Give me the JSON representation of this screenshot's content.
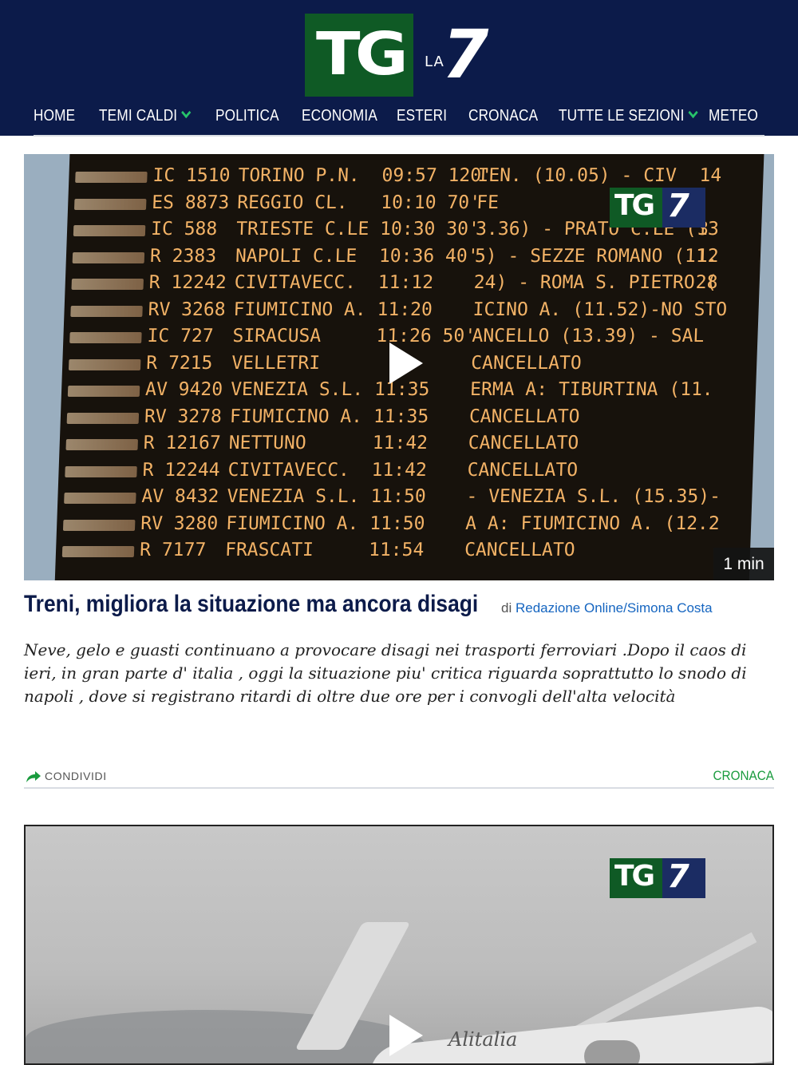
{
  "header": {
    "logo": {
      "tg": "TG",
      "la": "LA",
      "seven": "7"
    },
    "nav": [
      {
        "label": "HOME"
      },
      {
        "label": "TEMI CALDI"
      },
      {
        "label": "POLITICA"
      },
      {
        "label": "ECONOMIA"
      },
      {
        "label": "ESTERI"
      },
      {
        "label": "CRONACA"
      },
      {
        "label": "TUTTE LE SEZIONI"
      },
      {
        "label": "METEO"
      }
    ],
    "colors": {
      "background": "#0c1b4a",
      "accent": "#27c46a",
      "logo_green": "#0f5a25"
    }
  },
  "video1": {
    "duration": "1 min",
    "watermark": {
      "tg": "TG",
      "seven": "7"
    },
    "board_rows": [
      [
        "IC 1510",
        "TORINO P.N.",
        "09:57 120'",
        "IEN. (10.05) - CIV",
        "14"
      ],
      [
        "ES 8873",
        "REGGIO CL.",
        "10:10 70'",
        "FE",
        ""
      ],
      [
        "IC 588",
        "TRIESTE C.LE",
        "10:30 30'",
        "3.36) - PRATO C.LE (13",
        "3"
      ],
      [
        "R 2383",
        "NAPOLI C.LE",
        "10:36 40'",
        "5) - SEZZE ROMANO (11.",
        "12"
      ],
      [
        "R 12242",
        "CIVITAVECC.",
        "11:12",
        "24) - ROMA S. PIETRO (",
        "28"
      ],
      [
        "RV 3268",
        "FIUMICINO A.",
        "11:20",
        "ICINO A. (11.52)-NO STO",
        ""
      ],
      [
        "IC 727",
        "SIRACUSA",
        "11:26 50'",
        "ANCELLO (13.39) - SAL",
        ""
      ],
      [
        "R 7215",
        "VELLETRI",
        "",
        "CANCELLATO",
        ""
      ],
      [
        "AV 9420",
        "VENEZIA S.L.",
        "11:35",
        "ERMA A: TIBURTINA (11.",
        ""
      ],
      [
        "RV 3278",
        "FIUMICINO A.",
        "11:35",
        "CANCELLATO",
        ""
      ],
      [
        "R 12167",
        "NETTUNO",
        "11:42",
        "CANCELLATO",
        ""
      ],
      [
        "R 12244",
        "CIVITAVECC.",
        "11:42",
        "CANCELLATO",
        ""
      ],
      [
        "AV 8432",
        "VENEZIA S.L.",
        "11:50",
        "- VENEZIA S.L. (15.35)-",
        ""
      ],
      [
        "RV 3280",
        "FIUMICINO A.",
        "11:50",
        "A A: FIUMICINO A. (12.2",
        ""
      ],
      [
        "R 7177",
        "FRASCATI",
        "11:54",
        "CANCELLATO",
        ""
      ]
    ]
  },
  "article": {
    "title": "Treni, migliora la situazione ma ancora disagi",
    "by_prefix": "di",
    "author": "Redazione Online/Simona Costa",
    "summary": "Neve, gelo e guasti continuano a provocare  disagi nei trasporti ferroviari .Dopo il caos di ieri, in gran parte d' italia ,  oggi la situazione piu' critica riguarda soprattutto lo snodo di napoli , dove si registrano ritardi di oltre due ore per i convogli dell'alta velocità",
    "share_label": "CONDIVIDI",
    "category": "CRONACA"
  },
  "video2": {
    "watermark": {
      "tg": "TG",
      "seven": "7"
    },
    "plane_livery": "Alitalia"
  }
}
